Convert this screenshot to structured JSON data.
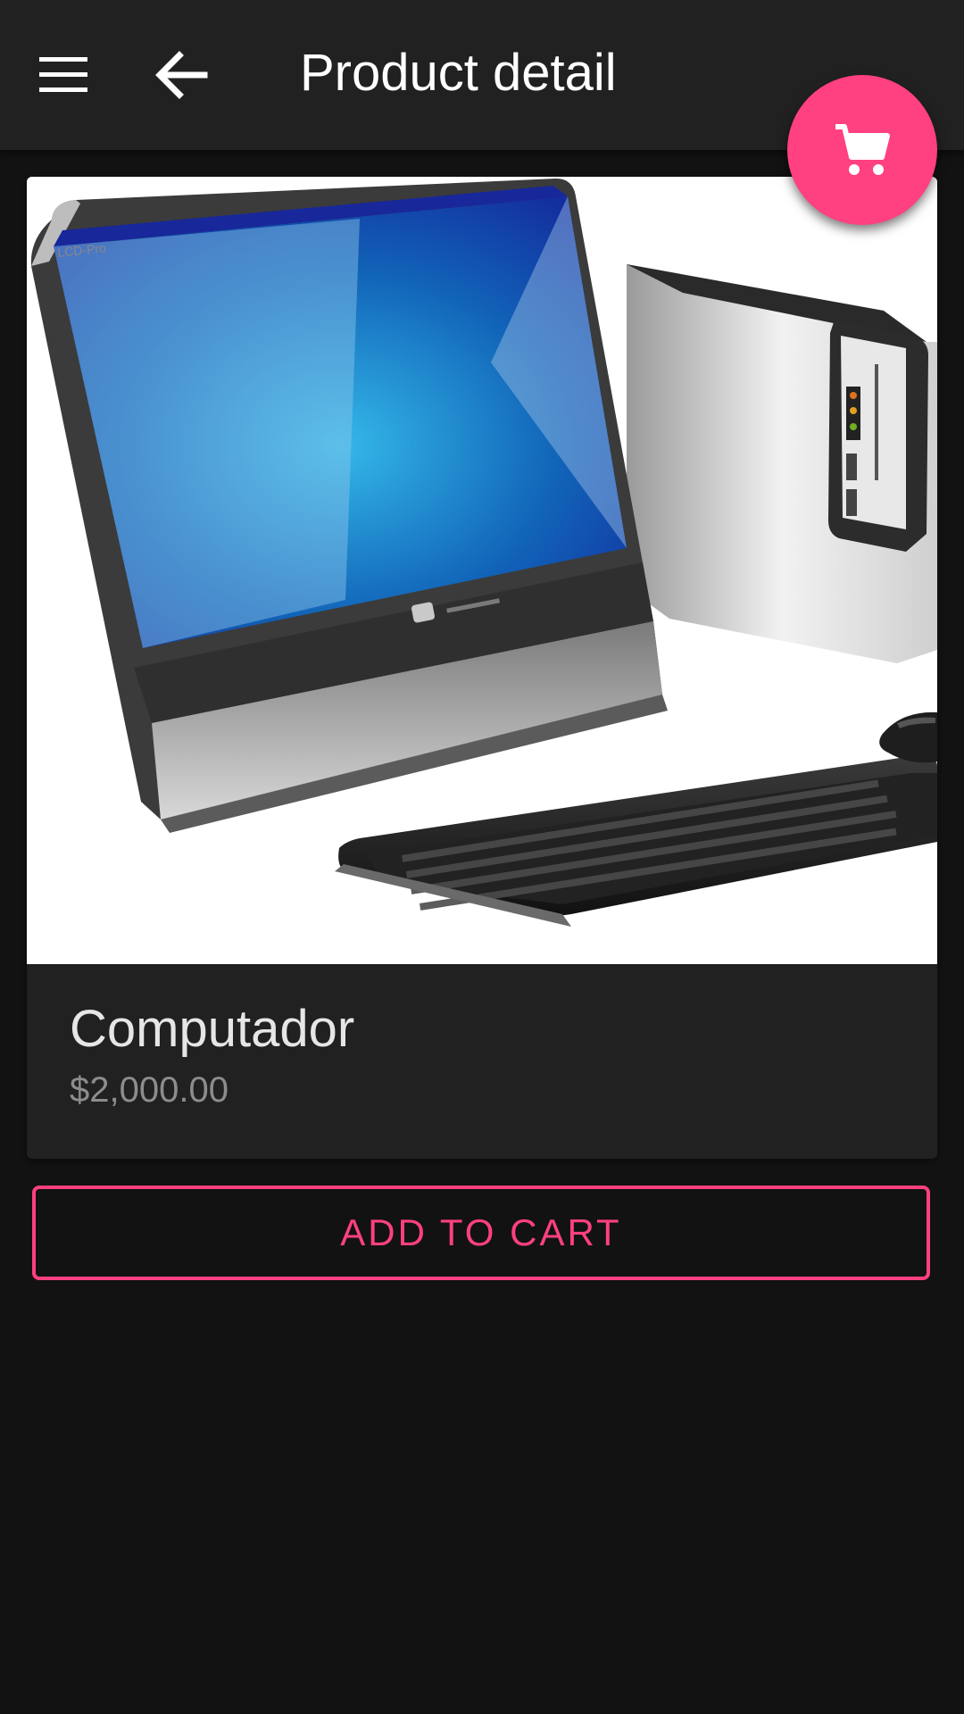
{
  "appbar": {
    "title": "Product detail",
    "menu_icon": "hamburger-menu-icon",
    "back_icon": "arrow-back-icon"
  },
  "fab": {
    "icon": "shopping-cart-icon",
    "color": "#ff4081"
  },
  "product": {
    "name": "Computador",
    "price": "$2,000.00",
    "image": "desktop-computer-illustration",
    "image_logo_text": "LCD-Pro"
  },
  "actions": {
    "add_to_cart_label": "ADD TO CART"
  },
  "colors": {
    "accent": "#ff4081",
    "background": "#121212",
    "appbar": "#212121",
    "card": "#212121"
  }
}
